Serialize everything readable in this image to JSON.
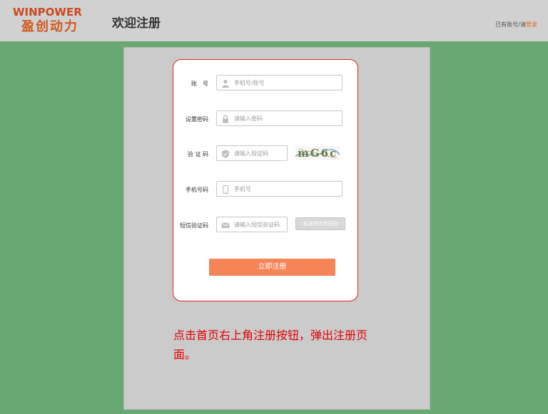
{
  "header": {
    "logo_en": "WINPOWER",
    "logo_cn": "盈创动力",
    "title": "欢迎注册",
    "login_prompt": "已有账号/请",
    "login_link": "登录"
  },
  "form": {
    "account_label": "账　号",
    "account_placeholder": "手机号/账号",
    "password_label": "设置密码",
    "password_placeholder": "请输入密码",
    "captcha_label": "验 证 码",
    "captcha_placeholder": "请输入验证码",
    "captcha_text": "mG6c",
    "phone_label": "手机号码",
    "phone_placeholder": "手机号",
    "sms_label": "短信验证码",
    "sms_placeholder": "请输入短信验证码",
    "sms_button": "发送短信验证码",
    "submit": "立即注册"
  },
  "annotation": "点击首页右上角注册按钮，弹出注册页面。",
  "colors": {
    "background": "#69a872",
    "accent": "#f58557",
    "brand": "#c94a1e",
    "annotation": "#e00000",
    "card_border": "#e02020"
  },
  "icons": [
    "user-icon",
    "lock-icon",
    "shield-icon",
    "phone-icon",
    "mail-icon"
  ]
}
